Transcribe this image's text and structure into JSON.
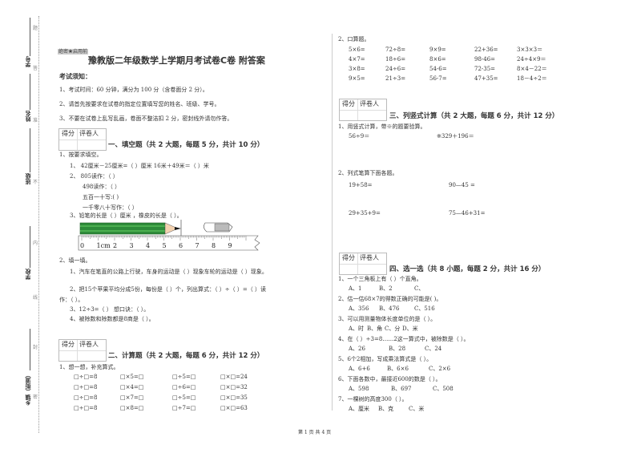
{
  "side": {
    "labels": [
      "学号",
      "姓名",
      "班级",
      "学校",
      "乡镇（街道）"
    ],
    "seal_chars": [
      "题",
      "答",
      "准",
      "不",
      "内",
      "线",
      "封",
      "密"
    ]
  },
  "header": {
    "secret": "绝密★启用前",
    "title": "豫教版二年级数学上学期月考试卷C卷 附答案",
    "notice_title": "考试须知：",
    "notices": [
      "1、考试时间：60 分钟，满分为 100 分（含卷面分 2 分）。",
      "2、请首先按要求在试卷的指定位置填写您的姓名、班级、学号。",
      "3、不要在试卷上乱写乱画，卷面不整洁扣 2 分，密封线外请勿作答。"
    ]
  },
  "score_box": {
    "score": "得分",
    "grader": "评卷人"
  },
  "section1": {
    "title": "一、填空题（共 2 大题，每题 5 分，共计 10 分）",
    "q1": "1、按要求填空。",
    "q1_items": [
      "1、 42厘米－25厘米=（        ）厘米   16米＋49米＝（          ）米",
      "2、 805读作：（                             ）",
      "498读作：（                             ）",
      "五百一十写:(                             )",
      "一千零八十写作：（                       ）",
      "3、铅笔的长是（        ）厘米  ，橡皮的长是（          ）。"
    ],
    "ruler": {
      "labels": [
        "0",
        "1cm",
        "2",
        "3",
        "4",
        "5",
        "6",
        "7",
        "8",
        "9"
      ],
      "pencil_length_cm": 6
    },
    "q2": "2、填一填。",
    "q2_items": [
      "1、汽车在笔直的公路上行驶，车身的运动是（          ）现象车轮的运动是（     ）现象。",
      "2、把15个苹果平均分成5份，每份是（    ）个，列出算式：（     ）÷（     ）=（     ）读",
      "作：（                         ）。",
      "3、12÷3=（     ）  想口诀：（                ）。",
      "4、被除数和除数都是8商是（       ）。"
    ]
  },
  "section2": {
    "title": "二、计算题（共 2 大题，每题 6 分，共计 12 分）",
    "q1": "1、想一想，补充算式。",
    "grid": [
      [
        "□÷□=8",
        "□×5=□",
        "□÷5=□",
        "□×□=24"
      ],
      [
        "□÷□=8",
        "□×4=□",
        "□÷6=□",
        "□×□=32"
      ],
      [
        "□÷□=8",
        "□×7=□",
        "□÷5=□",
        "□×□=35"
      ],
      [
        "□÷□=8",
        "□×8=□",
        "□÷7=□",
        "□×□=63"
      ]
    ]
  },
  "right": {
    "q2": "2、口算题。",
    "oral": [
      [
        "5×6=",
        "72÷8=",
        "9×9=",
        "22+36=",
        "3×3×3＝"
      ],
      [
        "4×7=",
        "18÷6=",
        "8×6=",
        "98-46=",
        "24÷4×9＝"
      ],
      [
        "3×8=",
        "24÷6=",
        "54-6=",
        "72-35=",
        "8×4－22＝"
      ],
      [
        "9×5=",
        "21÷3=",
        "56-7=",
        "47+35=",
        "18－4÷2＝"
      ]
    ]
  },
  "section3": {
    "title": "三、列竖式计算（共 2 大题，每题 6 分，共计 12 分）",
    "q1": "1、用竖式计算，带※的题要验算。",
    "q1_items": [
      "56÷9＝",
      "※329＋196＝"
    ],
    "q2": "2、列式笔算下面各题。",
    "q2_items": [
      "19+58=",
      "90—45 =",
      "29+35+9=",
      "75—46+31="
    ]
  },
  "section4": {
    "title": "四、选一选（共 8 小题，每题 2 分，共计 16 分）",
    "questions": [
      {
        "q": "1、一个三角板上有（    ）个直角。",
        "options": [
          "A、1",
          "B、2",
          "C、"
        ]
      },
      {
        "q": "2、估一估68×7的得数正确的可能是(      )。",
        "options": [
          "A、356",
          "B、476",
          "C、516"
        ]
      },
      {
        "q": "3、可以用测量物体长度单位的是（      ）。",
        "options": [
          "A、时",
          "B、角",
          "C、分",
          "D、米"
        ]
      },
      {
        "q": "4、在（     ）÷3=8……2这一算式中，被除数是（        ）。",
        "options": [
          "A、26",
          "B、28",
          "C、24"
        ]
      },
      {
        "q": "5、6个2相加，写成乘法算式是（      ）。",
        "options": [
          "A、6+6",
          "B、6×6",
          "C、2×6"
        ]
      },
      {
        "q": "6、下面各数中，最接近600的数是（         ）。",
        "options": [
          "A、598",
          "B、697",
          "C、508"
        ]
      },
      {
        "q": "7、一棵树的高度300（      ）。",
        "options": [
          "A、厘米",
          "B、克",
          "C、米"
        ]
      }
    ]
  },
  "footer": {
    "page": "第 1 页 共 4 页"
  }
}
